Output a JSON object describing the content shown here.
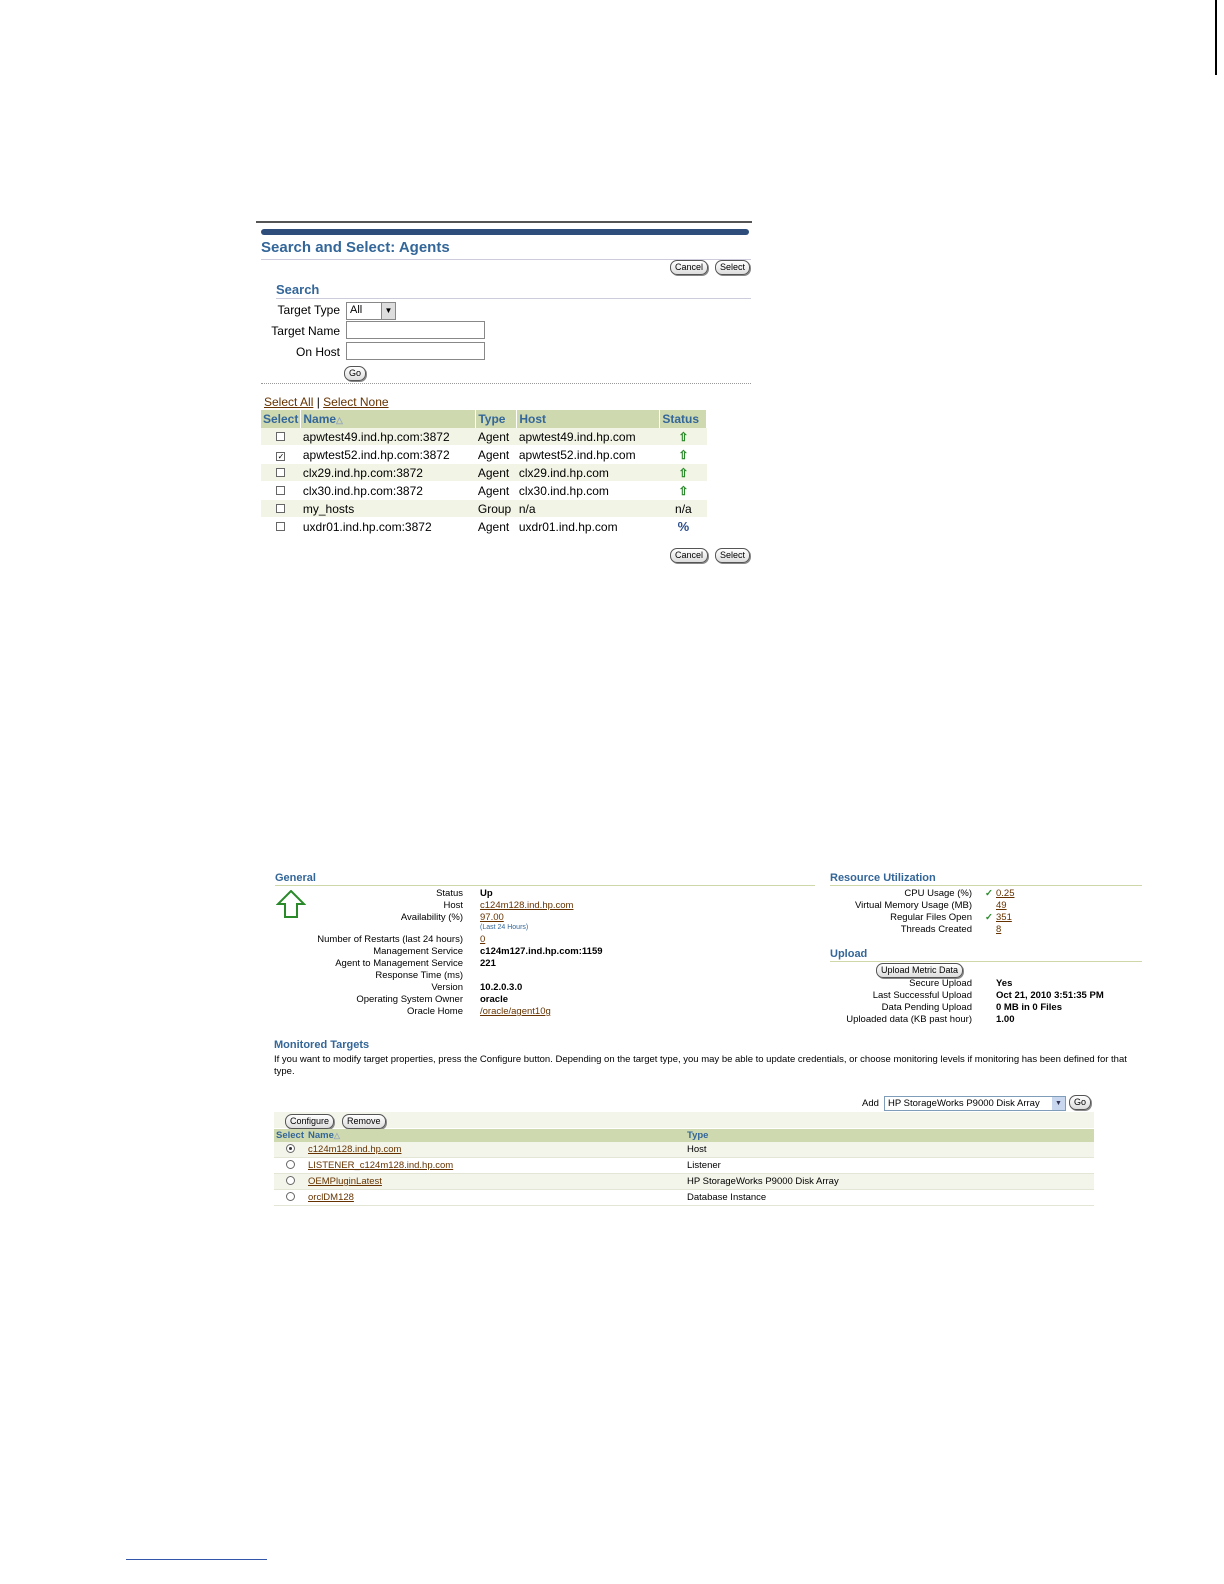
{
  "agents_dialog": {
    "title": "Search and Select: Agents",
    "cancel_label": "Cancel",
    "select_label": "Select",
    "search_heading": "Search",
    "target_type_label": "Target Type",
    "target_type_value": "All",
    "target_name_label": "Target Name",
    "on_host_label": "On Host",
    "go_label": "Go",
    "select_all_label": "Select All",
    "separator": "|",
    "select_none_label": "Select None",
    "columns": [
      "Select",
      "Name",
      "Type",
      "Host",
      "Status"
    ],
    "sort_indicator": "△",
    "rows": [
      {
        "checked": false,
        "name": "apwtest49.ind.hp.com:3872",
        "type": "Agent",
        "host": "apwtest49.ind.hp.com",
        "status": "⇧"
      },
      {
        "checked": true,
        "name": "apwtest52.ind.hp.com:3872",
        "type": "Agent",
        "host": "apwtest52.ind.hp.com",
        "status": "⇧"
      },
      {
        "checked": false,
        "name": "clx29.ind.hp.com:3872",
        "type": "Agent",
        "host": "clx29.ind.hp.com",
        "status": "⇧"
      },
      {
        "checked": false,
        "name": "clx30.ind.hp.com:3872",
        "type": "Agent",
        "host": "clx30.ind.hp.com",
        "status": "⇧"
      },
      {
        "checked": false,
        "name": "my_hosts",
        "type": "Group",
        "host": "n/a",
        "status": "n/a"
      },
      {
        "checked": false,
        "name": "uxdr01.ind.hp.com:3872",
        "type": "Agent",
        "host": "uxdr01.ind.hp.com",
        "status": "%"
      }
    ]
  },
  "agent_home": {
    "general_heading": "General",
    "general": [
      {
        "key": "Status",
        "value": "Up",
        "style": "bold"
      },
      {
        "key": "Host",
        "value": "c124m128.ind.hp.com",
        "style": "link"
      },
      {
        "key": "Availability (%)",
        "value": "97.00",
        "style": "link"
      },
      {
        "key": "",
        "value": "(Last 24 Hours)",
        "style": "note"
      },
      {
        "key": "Number of Restarts (last 24 hours)",
        "value": "0",
        "style": "link"
      },
      {
        "key": "Management Service",
        "value": "c124m127.ind.hp.com:1159",
        "style": "bold"
      },
      {
        "key": "Agent to Management Service",
        "value": "221",
        "style": "bold"
      },
      {
        "key": "Response Time (ms)",
        "value": "",
        "style": "bold"
      },
      {
        "key": "Version",
        "value": "10.2.0.3.0",
        "style": "bold"
      },
      {
        "key": "Operating System Owner",
        "value": "oracle",
        "style": "bold"
      },
      {
        "key": "Oracle Home",
        "value": "/oracle/agent10g",
        "style": "link"
      }
    ],
    "resource_heading": "Resource Utilization",
    "resource": [
      {
        "key": "CPU Usage (%)",
        "value": "0.25",
        "check": true
      },
      {
        "key": "Virtual Memory Usage (MB)",
        "value": "49",
        "check": false
      },
      {
        "key": "Regular Files Open",
        "value": "351",
        "check": true
      },
      {
        "key": "Threads Created",
        "value": "8",
        "check": false
      }
    ],
    "upload_heading": "Upload",
    "upload_button": "Upload Metric Data",
    "upload": [
      {
        "key": "Secure Upload",
        "value": "Yes"
      },
      {
        "key": "Last Successful Upload",
        "value": "Oct 21, 2010 3:51:35 PM"
      },
      {
        "key": "Data Pending Upload",
        "value": "0 MB in 0 Files"
      },
      {
        "key": "Uploaded data (KB past hour)",
        "value": "1.00"
      }
    ],
    "monitored_heading": "Monitored Targets",
    "monitored_desc": "If you want to modify target properties, press the Configure button. Depending on the target type, you may be able to update credentials, or choose monitoring levels if monitoring has been defined for that type.",
    "add_label": "Add",
    "add_select_value": "HP StorageWorks P9000 Disk Array",
    "go_label": "Go",
    "configure_label": "Configure",
    "remove_label": "Remove",
    "columns": [
      "Select",
      "Name",
      "Type"
    ],
    "sort_indicator": "△",
    "targets": [
      {
        "selected": true,
        "name": "c124m128.ind.hp.com",
        "type": "Host"
      },
      {
        "selected": false,
        "name": "LISTENER_c124m128.ind.hp.com",
        "type": "Listener"
      },
      {
        "selected": false,
        "name": "OEMPluginLatest",
        "type": "HP StorageWorks P9000 Disk Array"
      },
      {
        "selected": false,
        "name": "orclDM128",
        "type": "Database Instance"
      }
    ]
  }
}
